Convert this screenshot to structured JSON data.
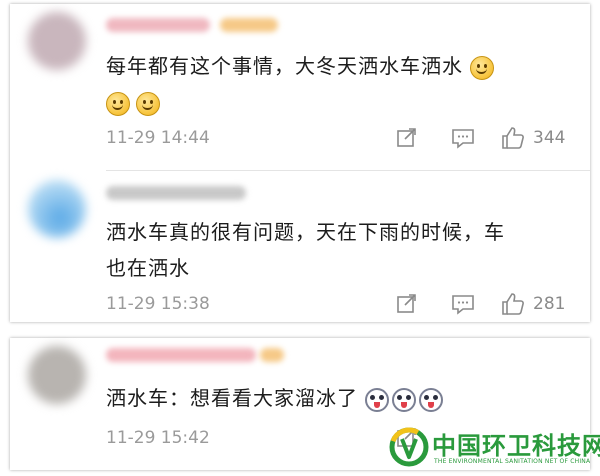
{
  "comments": [
    {
      "text": "每年都有这个事情，大冬天洒水车洒水",
      "emojis": [
        "smiley-emoji",
        "smiley-emoji",
        "smiley-emoji"
      ],
      "time": "11-29 14:44",
      "likes": "344",
      "icons": [
        "share-icon",
        "comment-icon",
        "like-icon"
      ]
    },
    {
      "text_line1": "洒水车真的很有问题，天在下雨的时候，车",
      "text_line2": "也在洒水",
      "time": "11-29 15:38",
      "likes": "281",
      "icons": [
        "share-icon",
        "comment-icon",
        "like-icon"
      ]
    },
    {
      "text": "洒水车：想看看大家溜冰了",
      "emojis": [
        "husky-emoji",
        "husky-emoji",
        "husky-emoji"
      ],
      "time": "11-29 15:42",
      "likes": "",
      "icons": [
        "share-icon",
        "comment-icon",
        "like-icon"
      ]
    }
  ],
  "watermark": {
    "title": "中国环卫科技网",
    "subtitle": "THE ENVIRONMENTAL SANITATION NET OF CHINA",
    "color": "#2a9a3c"
  },
  "colors": {
    "text": "#1c1c1c",
    "meta": "#9a9a9a",
    "divider": "#e4e4e4"
  }
}
